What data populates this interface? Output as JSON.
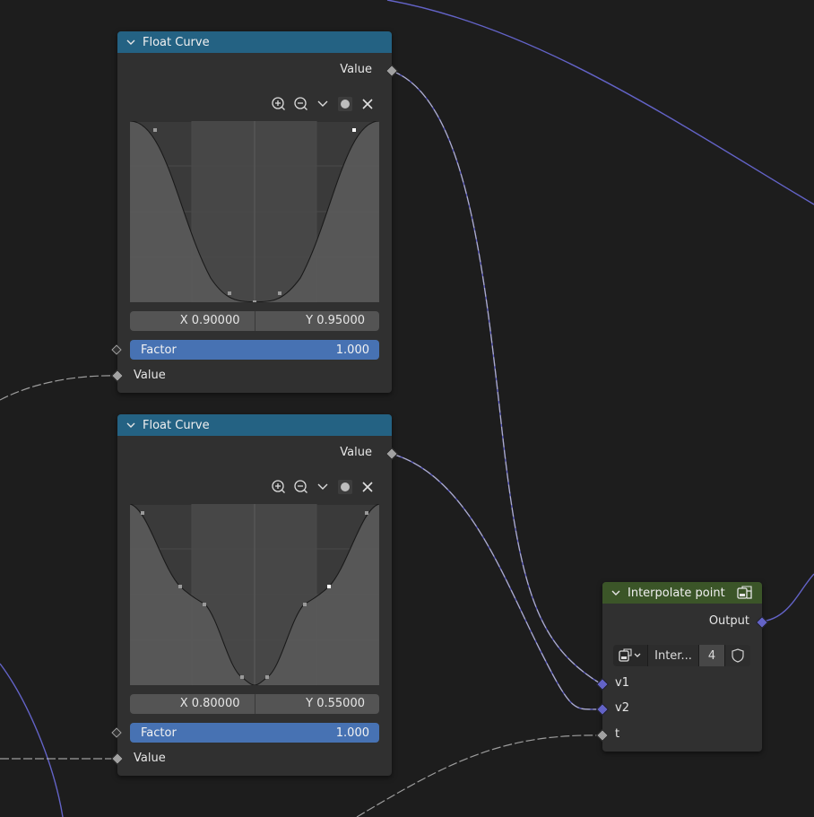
{
  "float_curve_nodes": [
    {
      "title": "Float Curve",
      "output_label": "Value",
      "x_field": "X 0.90000",
      "y_field": "Y 0.95000",
      "factor_label": "Factor",
      "factor_value": "1.000",
      "value_input_label": "Value"
    },
    {
      "title": "Float Curve",
      "output_label": "Value",
      "x_field": "X 0.80000",
      "y_field": "Y 0.55000",
      "factor_label": "Factor",
      "factor_value": "1.000",
      "value_input_label": "Value"
    }
  ],
  "interpolate_node": {
    "title": "Interpolate point",
    "output_label": "Output",
    "group_name": "Inter...",
    "user_count": "4",
    "inputs": [
      "v1",
      "v2",
      "t"
    ]
  },
  "icons": [
    "zoom-in-icon",
    "zoom-out-icon",
    "chevron-down-icon",
    "clipping-dot-icon",
    "close-icon",
    "node-group-icon",
    "shield-icon"
  ],
  "colors": {
    "float_curve_header": "#246283",
    "interpolate_header": "#3b5528",
    "factor_slider": "#4772b3",
    "vector_socket": "#6363c7",
    "float_socket": "#a1a1a1",
    "vector_link": "#6363c7",
    "float_link": "#b4b4b4",
    "background": "#1d1d1d"
  }
}
